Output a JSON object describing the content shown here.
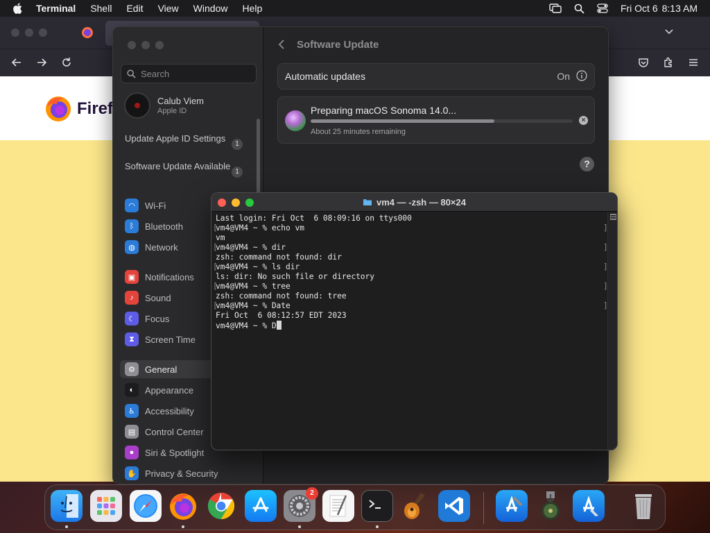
{
  "menubar": {
    "app_name": "Terminal",
    "items": [
      "Shell",
      "Edit",
      "View",
      "Window",
      "Help"
    ],
    "date": "Fri Oct 6",
    "time": "8:13 AM"
  },
  "firefox": {
    "brand_text": "Firefo"
  },
  "settings": {
    "search_placeholder": "Search",
    "profile_name": "Calub Viem",
    "profile_sub": "Apple ID",
    "notices": [
      {
        "label": "Update Apple ID Settings",
        "badge": "1"
      },
      {
        "label": "Software Update Available",
        "badge": "1"
      }
    ],
    "sidebar_items": [
      {
        "label": "Wi-Fi",
        "icon": "wifi-icon",
        "color": "#2b7bd8"
      },
      {
        "label": "Bluetooth",
        "icon": "bluetooth-icon",
        "color": "#2b7bd8"
      },
      {
        "label": "Network",
        "icon": "network-icon",
        "color": "#2b7bd8"
      },
      {
        "label": "Notifications",
        "icon": "notifications-icon",
        "color": "#e3443b"
      },
      {
        "label": "Sound",
        "icon": "sound-icon",
        "color": "#e3443b"
      },
      {
        "label": "Focus",
        "icon": "focus-icon",
        "color": "#5e5ce6"
      },
      {
        "label": "Screen Time",
        "icon": "screen-time-icon",
        "color": "#5e5ce6"
      },
      {
        "label": "General",
        "icon": "general-icon",
        "color": "#8e8e93"
      },
      {
        "label": "Appearance",
        "icon": "appearance-icon",
        "color": "#1c1c1e"
      },
      {
        "label": "Accessibility",
        "icon": "accessibility-icon",
        "color": "#2b7bd8"
      },
      {
        "label": "Control Center",
        "icon": "control-center-icon",
        "color": "#8e8e93"
      },
      {
        "label": "Siri & Spotlight",
        "icon": "siri-icon",
        "color": "#a83ec9"
      },
      {
        "label": "Privacy & Security",
        "icon": "privacy-icon",
        "color": "#2b7bd8"
      }
    ],
    "selected_item": "General",
    "title": "Software Update",
    "automatic_updates_label": "Automatic updates",
    "automatic_updates_value": "On",
    "update_title": "Preparing macOS Sonoma 14.0...",
    "update_remaining": "About 25 minutes remaining",
    "update_progress": 0.7
  },
  "terminal": {
    "title": "vm4 — -zsh — 80×24",
    "lines": [
      {
        "text": "Last login: Fri Oct  6 08:09:16 on ttys000",
        "mark": false
      },
      {
        "text": "vm4@VM4 ~ % echo vm",
        "mark": true
      },
      {
        "text": "vm",
        "mark": false
      },
      {
        "text": "vm4@VM4 ~ % dir",
        "mark": true
      },
      {
        "text": "zsh: command not found: dir",
        "mark": false
      },
      {
        "text": "vm4@VM4 ~ % ls dir",
        "mark": true
      },
      {
        "text": "ls: dir: No such file or directory",
        "mark": false
      },
      {
        "text": "vm4@VM4 ~ % tree",
        "mark": true
      },
      {
        "text": "zsh: command not found: tree",
        "mark": false
      },
      {
        "text": "vm4@VM4 ~ % Date",
        "mark": true
      },
      {
        "text": "Fri Oct  6 08:12:57 EDT 2023",
        "mark": false
      }
    ],
    "prompt_line": "vm4@VM4 ~ % D"
  },
  "dock": {
    "apps": [
      {
        "name": "finder-icon",
        "running": true
      },
      {
        "name": "launchpad-icon",
        "running": false
      },
      {
        "name": "safari-icon",
        "running": false
      },
      {
        "name": "firefox-icon",
        "running": true
      },
      {
        "name": "chrome-icon",
        "running": false
      },
      {
        "name": "app-store-icon",
        "running": false
      },
      {
        "name": "system-settings-icon",
        "running": true
      },
      {
        "name": "textedit-icon",
        "running": false
      },
      {
        "name": "terminal-icon",
        "running": true
      },
      {
        "name": "garageband-icon",
        "running": false
      },
      {
        "name": "vscode-icon",
        "running": false
      },
      {
        "name": "xcode-icon",
        "running": false
      },
      {
        "name": "installer-icon",
        "running": false
      },
      {
        "name": "simulator-icon",
        "running": false
      },
      {
        "name": "trash-icon",
        "running": false
      }
    ],
    "settings_badge": "2"
  }
}
